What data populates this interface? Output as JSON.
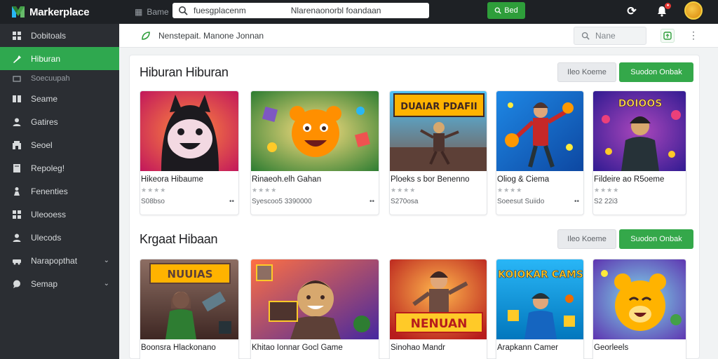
{
  "app": {
    "brand": "Markerplace"
  },
  "topbar": {
    "menu_label": "Bame",
    "search_query": "fuesgplacenm",
    "search_hint": "Nlarenaonorbl foandaan",
    "search_button": "Bed"
  },
  "sidebar": {
    "items": [
      {
        "label": "Dobitoals",
        "icon": "grid-icon",
        "active": false
      },
      {
        "label": "Hiburan",
        "icon": "puzzle-icon",
        "active": true
      },
      {
        "label": "Soecuupah",
        "icon": "folder-icon",
        "sub": true
      },
      {
        "label": "Seame",
        "icon": "gamepad-icon"
      },
      {
        "label": "Gatires",
        "icon": "user-icon"
      },
      {
        "label": "Seoel",
        "icon": "store-icon"
      },
      {
        "label": "Repoleg!",
        "icon": "book-icon"
      },
      {
        "label": "Fenenties",
        "icon": "person-icon"
      },
      {
        "label": "Uleooess",
        "icon": "grid-icon"
      },
      {
        "label": "Ulecods",
        "icon": "user-icon"
      },
      {
        "label": "Narapopthat",
        "icon": "car-icon",
        "chevron": true
      },
      {
        "label": "Semap",
        "icon": "chat-icon",
        "chevron": true
      }
    ]
  },
  "breadcrumb": {
    "text": "Nenstepait. Manone Jonnan",
    "filter_placeholder": "Nane"
  },
  "sections": [
    {
      "title": "Hiburan Hiburan",
      "ghost_button": "Ileo Koeme",
      "green_button": "Suodon Onbak",
      "cards": [
        {
          "title": "Hikeora Hibaume",
          "price": "S08bso",
          "extra": "••"
        },
        {
          "title": "Rinaeoh.elh Gahan",
          "price": "Syescoo5 3390000",
          "extra": "••"
        },
        {
          "title": "Ploeks s bor Benenno",
          "price": "S270osa",
          "extra": ""
        },
        {
          "title": "Oliog & Ciema",
          "price": "Soeesut Suiido",
          "extra": "••"
        },
        {
          "title": "Fildeire ao R5oeme",
          "price": "S2 22i3",
          "extra": ""
        }
      ]
    },
    {
      "title": "Krgaat Hibaan",
      "ghost_button": "Ileo Koeme",
      "green_button": "Suodon Onbak",
      "cards": [
        {
          "title": "Boonsra Hlackonano"
        },
        {
          "title": "Khitao Ionnar Gocl Game"
        },
        {
          "title": "Sinohao Mandr"
        },
        {
          "title": "Arapkann Camer"
        },
        {
          "title": "Georleels"
        }
      ]
    }
  ],
  "thumb_texts": [
    "DUAIAR PDAFII",
    "DOIOOS",
    "NUUIAS",
    "NENUAN",
    "KOIOKAR CAMS"
  ],
  "stars": "★★★★",
  "colors": {
    "accent": "#34a84a",
    "sidebar": "#2b2e33",
    "topbar": "#1e2125"
  }
}
